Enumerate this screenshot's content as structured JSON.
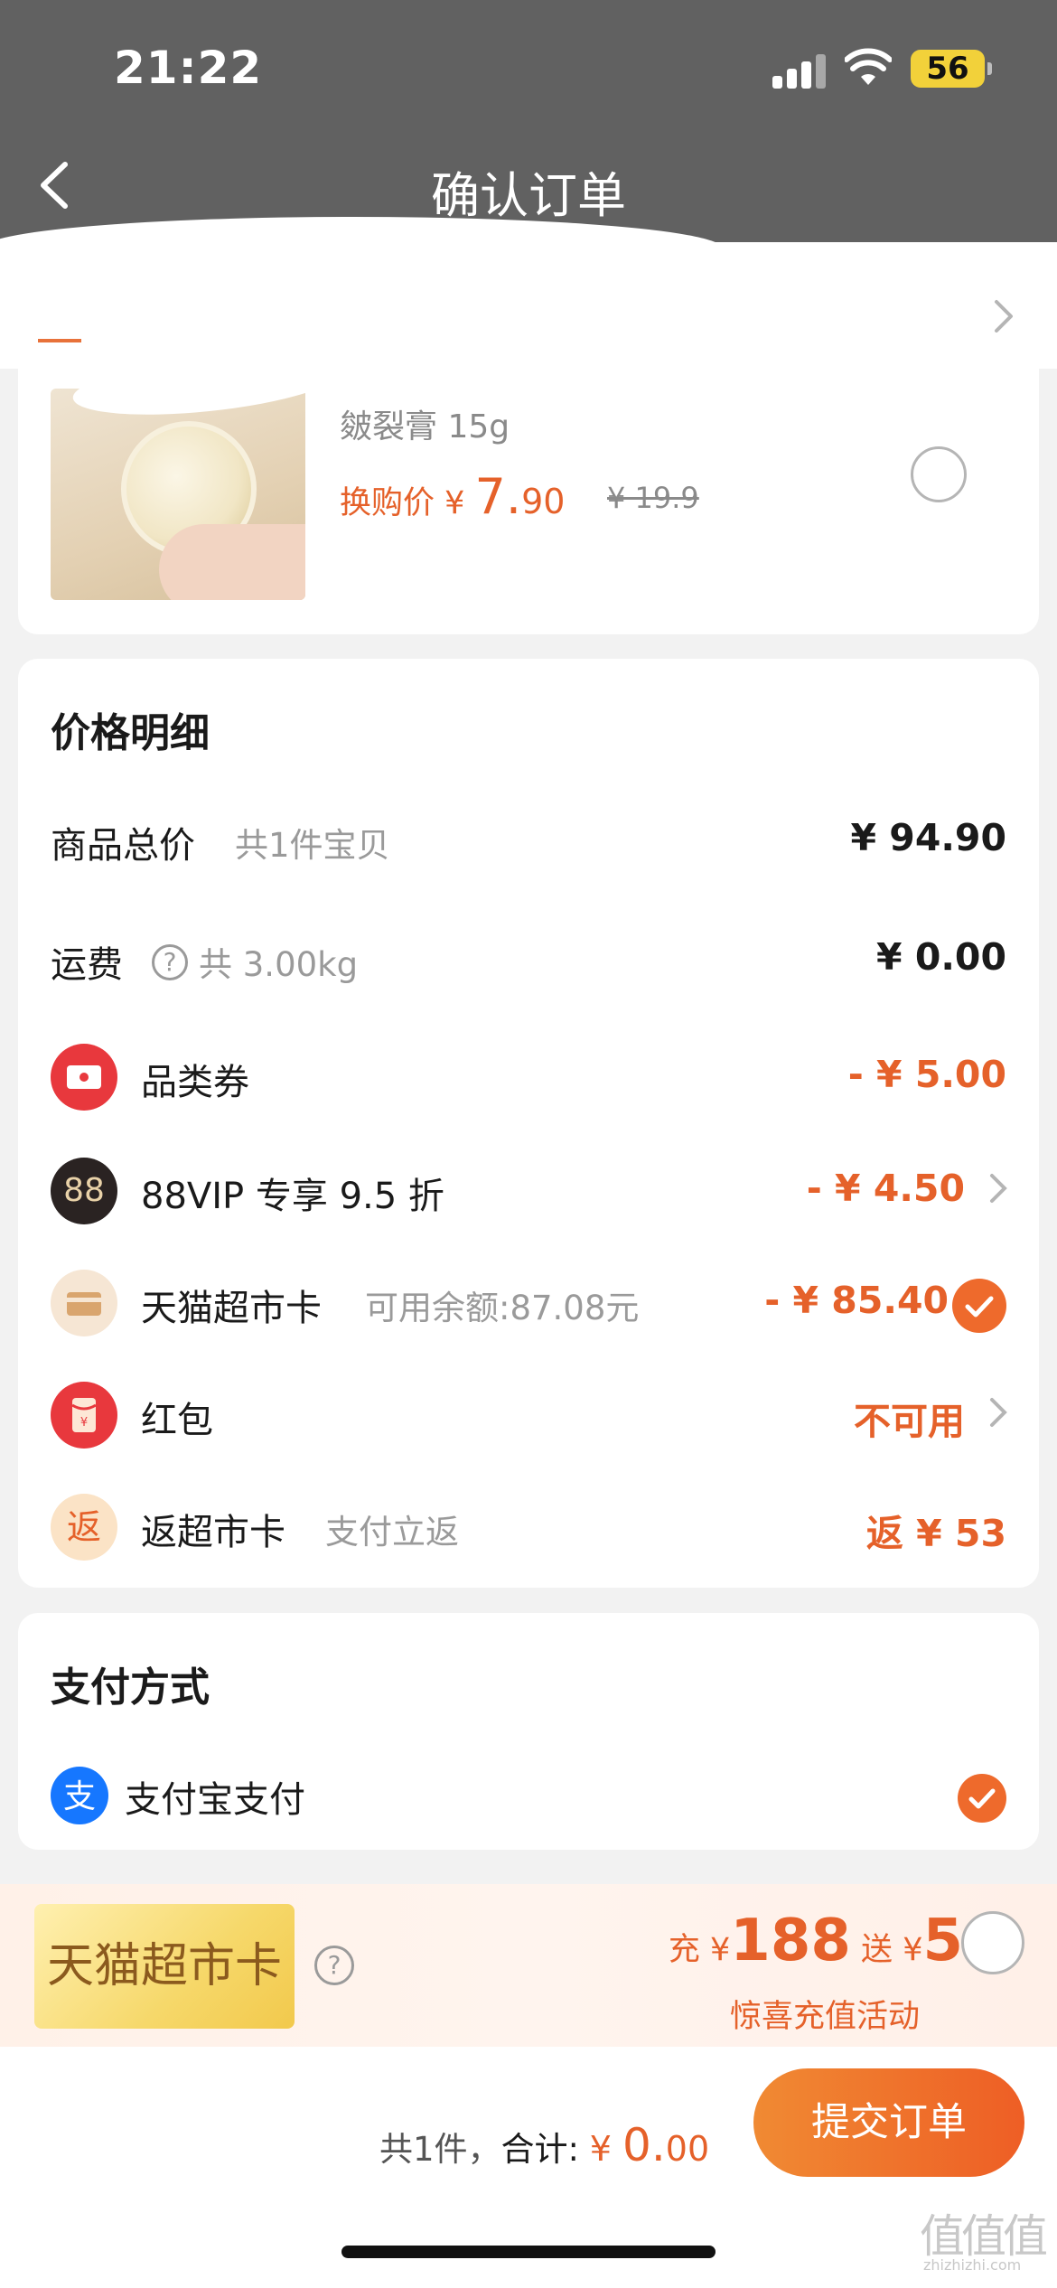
{
  "status_bar": {
    "time": "21:22",
    "battery": "56"
  },
  "header": {
    "title": "确认订单"
  },
  "product": {
    "subtitle": "皴裂膏 15g",
    "price_label": "换购价 ¥ ",
    "price_int": "7.",
    "price_dec": "90",
    "original_price": "¥ 19.9"
  },
  "price_detail": {
    "title": "价格明细",
    "goods_total": {
      "label": "商品总价",
      "sub": "共1件宝贝",
      "value": "¥ 94.90"
    },
    "shipping": {
      "label": "运费",
      "sub": "共 3.00kg",
      "value": "¥ 0.00"
    },
    "coupon": {
      "label": "品类券",
      "value": "- ¥ 5.00"
    },
    "vip": {
      "icon_text": "88",
      "label": "88VIP 专享 9.5 折",
      "value": "- ¥ 4.50"
    },
    "supermarket_card": {
      "label": "天猫超市卡",
      "sub": "可用余额:87.08元",
      "value": "- ¥ 85.40"
    },
    "red_packet": {
      "label": "红包",
      "value": "不可用"
    },
    "cashback": {
      "icon_text": "返",
      "label": "返超市卡",
      "sub": "支付立返",
      "value": "返 ¥ 53"
    }
  },
  "payment": {
    "title": "支付方式",
    "method": "支付宝支付"
  },
  "promo": {
    "tag": "天猫超市卡",
    "recharge_label": "充",
    "currency": "¥",
    "recharge_amount": "188",
    "bonus_label": "送",
    "bonus_amount": "5",
    "subtitle": "惊喜充值活动"
  },
  "footer": {
    "count": "共1件，",
    "total_label": "合计: ",
    "currency": "¥ ",
    "total_int": "0.",
    "total_dec": "00",
    "submit_label": "提交订单"
  },
  "watermark": {
    "logo": "值值值",
    "domain": "zhizhizhi.com"
  },
  "colors": {
    "accent": "#e5612a",
    "header_bg": "#616161",
    "check": "#ee6a2c"
  }
}
